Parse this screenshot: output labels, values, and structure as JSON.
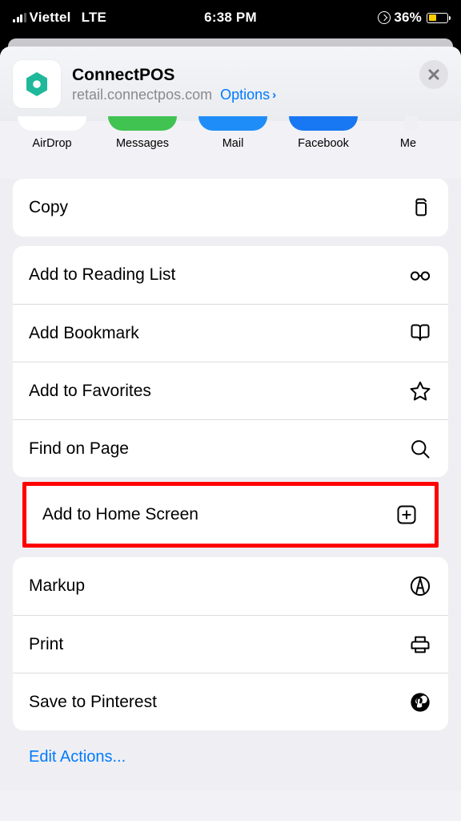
{
  "status": {
    "carrier": "Viettel",
    "network": "LTE",
    "time": "6:38 PM",
    "battery_pct": "36%"
  },
  "header": {
    "title": "ConnectPOS",
    "domain": "retail.connectpos.com",
    "options": "Options"
  },
  "share": {
    "items": [
      "AirDrop",
      "Messages",
      "Mail",
      "Facebook",
      "Me"
    ]
  },
  "actions": {
    "copy": "Copy",
    "reading": "Add to Reading List",
    "bookmark": "Add Bookmark",
    "favorites": "Add to Favorites",
    "find": "Find on Page",
    "homescreen": "Add to Home Screen",
    "markup": "Markup",
    "print": "Print",
    "pinterest": "Save to Pinterest",
    "edit": "Edit Actions..."
  }
}
